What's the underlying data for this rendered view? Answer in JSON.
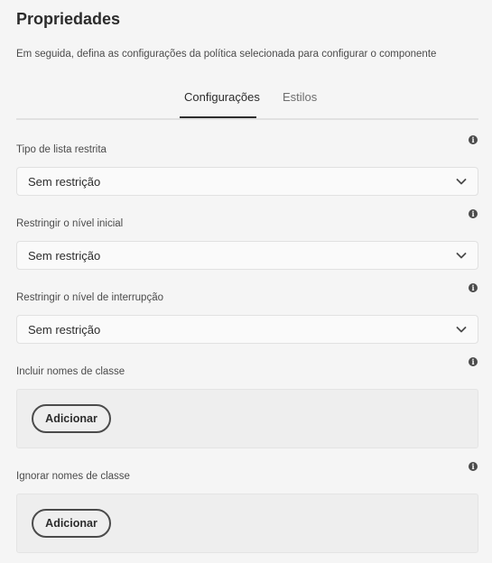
{
  "header": {
    "title": "Propriedades",
    "subtitle": "Em seguida, defina as configurações da política selecionada para configurar o componente"
  },
  "tabs": [
    {
      "label": "Configurações",
      "active": true
    },
    {
      "label": "Estilos",
      "active": false
    }
  ],
  "fields": {
    "list_type": {
      "label": "Tipo de lista restrita",
      "value": "Sem restrição"
    },
    "start_level": {
      "label": "Restringir o nível inicial",
      "value": "Sem restrição"
    },
    "stop_level": {
      "label": "Restringir o nível de interrupção",
      "value": "Sem restrição"
    },
    "include_classes": {
      "label": "Incluir nomes de classe",
      "button": "Adicionar"
    },
    "ignore_classes": {
      "label": "Ignorar nomes de classe",
      "button": "Adicionar"
    }
  },
  "icons": {
    "info": "info-icon",
    "dropdown": "chevron-down-icon"
  },
  "colors": {
    "background": "#f5f5f5",
    "text": "#2c2c2c",
    "muted_text": "#4b4b4b",
    "tab_underline": "#2c2c2c"
  }
}
